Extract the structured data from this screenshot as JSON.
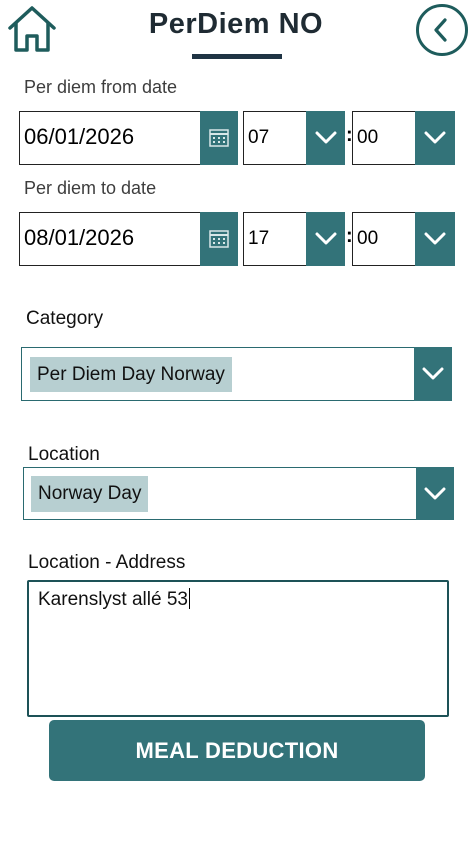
{
  "header": {
    "title": "PerDiem NO"
  },
  "from": {
    "label": "Per diem from date",
    "date": "06/01/2026",
    "hour": "07",
    "minute": "00"
  },
  "to": {
    "label": "Per diem to date",
    "date": "08/01/2026",
    "hour": "17",
    "minute": "00"
  },
  "time_separator": ":",
  "category": {
    "label": "Category",
    "value": "Per Diem Day Norway"
  },
  "location": {
    "label": "Location",
    "value": "Norway Day"
  },
  "address": {
    "label": "Location - Address",
    "value": "Karenslyst allé 53"
  },
  "actions": {
    "meal_deduction": "MEAL DEDUCTION"
  },
  "colors": {
    "accent": "#337379",
    "chip": "#b7cfd1",
    "title": "#1f2b33"
  },
  "icons": {
    "home": "home-icon",
    "back": "chevron-left-icon",
    "calendar": "calendar-icon",
    "dropdown": "chevron-down-icon"
  }
}
